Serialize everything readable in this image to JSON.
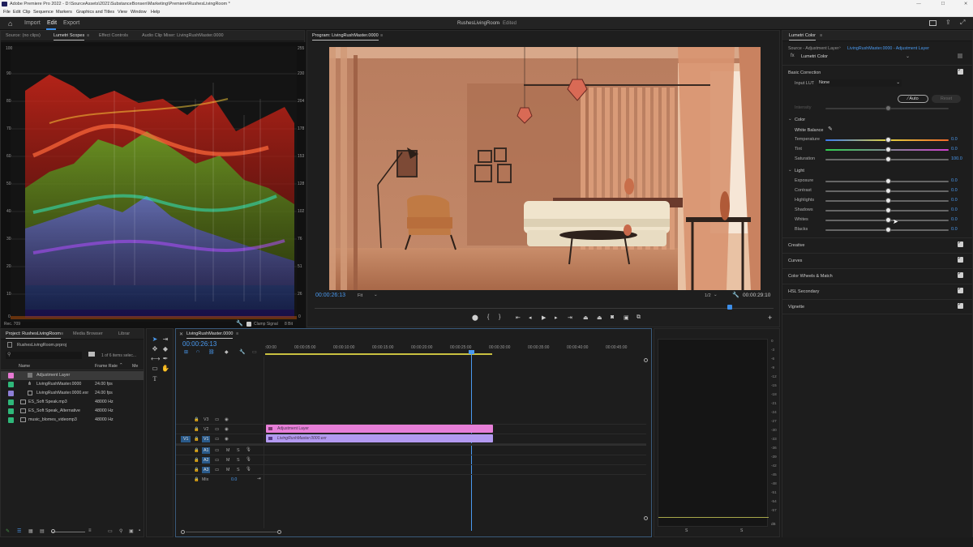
{
  "window": {
    "title": "Adobe Premiere Pro 2022 - D:\\SourceAssets\\2021\\SubstanceBonsen\\Marketing\\Premiere\\RushesLivingRoom *"
  },
  "menu": [
    "File",
    "Edit",
    "Clip",
    "Sequence",
    "Markers",
    "Graphics and Titles",
    "View",
    "Window",
    "Help"
  ],
  "header": {
    "tabs": [
      "Import",
      "Edit",
      "Export"
    ],
    "active_tab": "Edit",
    "project_name": "RushesLivingRoom",
    "status": "Edited"
  },
  "scopes_panel": {
    "tabs": [
      "Source: (no clips)",
      "Lumetri Scopes",
      "Effect Controls",
      "Audio Clip Mixer: LivingRushMaster.0000"
    ],
    "left_scale": [
      "100",
      "90",
      "80",
      "70",
      "60",
      "50",
      "40",
      "30",
      "20",
      "10",
      "0"
    ],
    "right_scale": [
      "255",
      "230",
      "204",
      "178",
      "153",
      "128",
      "102",
      "76",
      "51",
      "26",
      "0"
    ],
    "footer_left": "Rec. 709",
    "clamp_signal": "Clamp Signal",
    "bit_depth": "8 Bit"
  },
  "program_monitor": {
    "title": "Program: LivingRushMaster.0000",
    "timecode": "00:00:26:13",
    "fit": "Fit",
    "resolution": "1/2",
    "duration": "00:00:29:10"
  },
  "lumetri": {
    "title": "Lumetri Color",
    "source": "Source - Adjustment Layer",
    "target": "LivingRushMaster.0000 - Adjustment Layer",
    "effect": "Lumetri Color",
    "basic_correction": "Basic Correction",
    "input_lut_label": "Input LUT",
    "input_lut_value": "None",
    "auto": "Auto",
    "reset": "Reset",
    "intensity": "Intensity",
    "color_header": "Color",
    "white_balance": "White Balance",
    "color_sliders": [
      {
        "label": "Temperature",
        "value": "0.0"
      },
      {
        "label": "Tint",
        "value": "0.0"
      },
      {
        "label": "Saturation",
        "value": "100.0"
      }
    ],
    "light_header": "Light",
    "light_sliders": [
      {
        "label": "Exposure",
        "value": "0.0"
      },
      {
        "label": "Contrast",
        "value": "0.0"
      },
      {
        "label": "Highlights",
        "value": "0.0"
      },
      {
        "label": "Shadows",
        "value": "0.0"
      },
      {
        "label": "Whites",
        "value": "0.0"
      },
      {
        "label": "Blacks",
        "value": "0.0"
      }
    ],
    "sections": [
      "Creative",
      "Curves",
      "Color Wheels & Match",
      "HSL Secondary",
      "Vignette"
    ]
  },
  "project_panel": {
    "tabs": [
      "Project: RushesLivingRoom",
      "Media Browser",
      "Librar"
    ],
    "file": "RushesLivingRoom.prproj",
    "count": "1 of 6 items selec...",
    "columns": [
      "Name",
      "Frame Rate",
      "Me"
    ],
    "items": [
      {
        "name": "Adjustment Layer",
        "rate": "",
        "color": "#e879d4"
      },
      {
        "name": "LivingRushMaster.0000",
        "rate": "24.00 fps",
        "color": "#2fb87a"
      },
      {
        "name": "LivingRushMaster.0000.exr",
        "rate": "24.00 fps",
        "color": "#8e7fd6"
      },
      {
        "name": "ES_Soft Speak.mp3",
        "rate": "48000 Hz",
        "color": "#2fb87a"
      },
      {
        "name": "ES_Soft Speak_Alternative",
        "rate": "48000 Hz",
        "color": "#2fb87a"
      },
      {
        "name": "music_blomes_videomp3",
        "rate": "48000 Hz",
        "color": "#2fb87a"
      }
    ]
  },
  "timeline": {
    "sequence": "LivingRushMaster.0000",
    "timecode": "00:00:26:13",
    "ruler": [
      ":00:00",
      "00:00:05:00",
      "00:00:10:00",
      "00:00:15:00",
      "00:00:20:00",
      "00:00:25:00",
      "00:00:30:00",
      "00:00:35:00",
      "00:00:40:00",
      "00:00:45:00"
    ],
    "video_tracks": [
      "V3",
      "V2",
      "V1"
    ],
    "audio_tracks": [
      "A1",
      "A2",
      "A3"
    ],
    "source_v": "V1",
    "mix": "Mix",
    "mix_value": "0.0",
    "clips": [
      {
        "name": "Adjustment Layer",
        "color": "#e77fd8"
      },
      {
        "name": "LivingRushMaster.0000.exr",
        "color": "#b39af0"
      }
    ]
  },
  "meters": {
    "scale": [
      "0",
      "-3",
      "-6",
      "-9",
      "-12",
      "-15",
      "-18",
      "-21",
      "-24",
      "-27",
      "-30",
      "-33",
      "-36",
      "-39",
      "-42",
      "-45",
      "-48",
      "-51",
      "-54",
      "-57",
      "dB"
    ],
    "channels": [
      "S",
      "S"
    ]
  }
}
